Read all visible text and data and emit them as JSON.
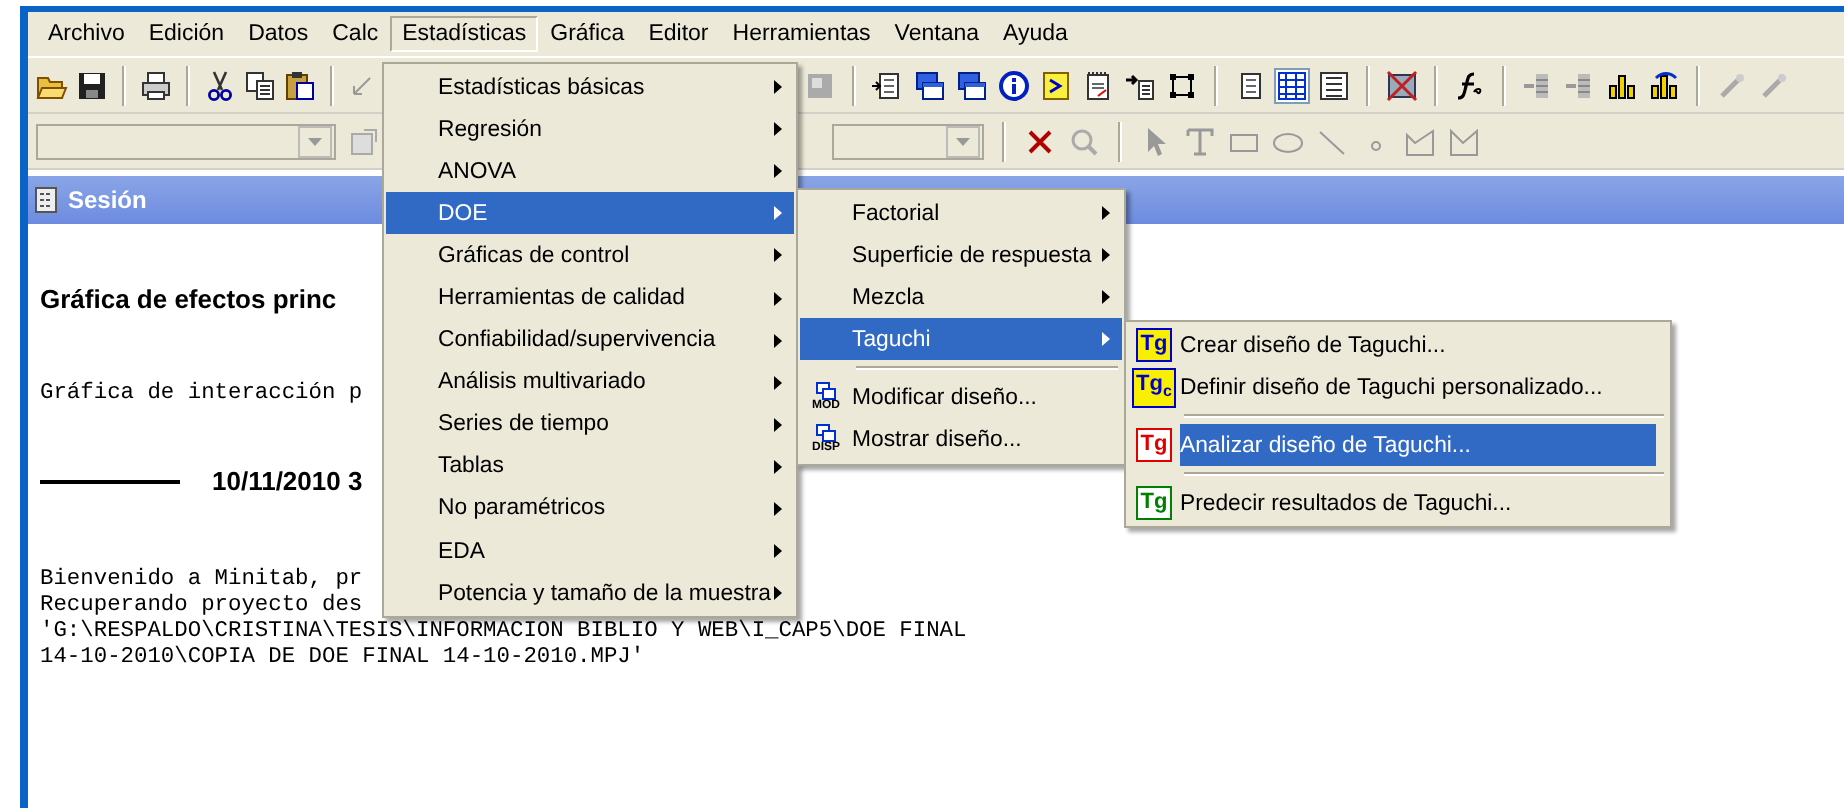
{
  "menu_bar": [
    {
      "label": "Archivo",
      "selected": false
    },
    {
      "label": "Edición",
      "selected": false
    },
    {
      "label": "Datos",
      "selected": false
    },
    {
      "label": "Calc",
      "selected": false
    },
    {
      "label": "Estadísticas",
      "selected": true
    },
    {
      "label": "Gráfica",
      "selected": false
    },
    {
      "label": "Editor",
      "selected": false
    },
    {
      "label": "Herramientas",
      "selected": false
    },
    {
      "label": "Ventana",
      "selected": false
    },
    {
      "label": "Ayuda",
      "selected": false
    }
  ],
  "session": {
    "title": "Sesión",
    "lines": [
      {
        "kind": "heading",
        "text": "Gráfica de efectos princ"
      },
      {
        "kind": "mono",
        "text": "Gráfica de interacción p"
      },
      {
        "kind": "dated",
        "text": "10/11/2010 3"
      },
      {
        "kind": "mono",
        "text": "Bienvenido a Minitab, pr"
      },
      {
        "kind": "mono",
        "text": "Recuperando proyecto des"
      },
      {
        "kind": "mono",
        "text": "'G:\\RESPALDO\\CRISTINA\\TESIS\\INFORMACION BIBLIO Y WEB\\I_CAP5\\DOE FINAL"
      },
      {
        "kind": "mono",
        "text": "14-10-2010\\COPIA DE DOE FINAL 14-10-2010.MPJ'"
      }
    ]
  },
  "stat_menu": [
    {
      "kind": "item",
      "label": "Estadísticas básicas",
      "selected": false
    },
    {
      "kind": "item",
      "label": "Regresión",
      "selected": false
    },
    {
      "kind": "item",
      "label": "ANOVA",
      "selected": false
    },
    {
      "kind": "item",
      "label": "DOE",
      "selected": true
    },
    {
      "kind": "item",
      "label": "Gráficas de control",
      "selected": false
    },
    {
      "kind": "item",
      "label": "Herramientas de calidad",
      "selected": false
    },
    {
      "kind": "item",
      "label": "Confiabilidad/supervivencia",
      "selected": false
    },
    {
      "kind": "item",
      "label": "Análisis multivariado",
      "selected": false
    },
    {
      "kind": "item",
      "label": "Series de tiempo",
      "selected": false
    },
    {
      "kind": "item",
      "label": "Tablas",
      "selected": false
    },
    {
      "kind": "item",
      "label": "No paramétricos",
      "selected": false
    },
    {
      "kind": "item",
      "label": "EDA",
      "selected": false
    },
    {
      "kind": "item",
      "label": "Potencia y tamaño de la muestra",
      "selected": false
    }
  ],
  "doe_menu": [
    {
      "kind": "submenu",
      "label": "Factorial",
      "selected": false
    },
    {
      "kind": "submenu",
      "label": "Superficie de respuesta",
      "selected": false
    },
    {
      "kind": "submenu",
      "label": "Mezcla",
      "selected": false
    },
    {
      "kind": "submenu",
      "label": "Taguchi",
      "selected": true
    },
    {
      "kind": "separator"
    },
    {
      "kind": "command",
      "label": "Modificar diseño...",
      "badge": "MOD",
      "selected": false
    },
    {
      "kind": "command",
      "label": "Mostrar diseño...",
      "badge": "DISP",
      "selected": false
    }
  ],
  "taguchi_menu": [
    {
      "kind": "command",
      "label": "Crear diseño de Taguchi...",
      "badge": "Tg",
      "color": "#0000cc",
      "selected": false
    },
    {
      "kind": "command",
      "label": "Definir diseño de Taguchi personalizado...",
      "badge": "Tg",
      "sub": "c",
      "color": "#0000cc",
      "selected": false
    },
    {
      "kind": "separator"
    },
    {
      "kind": "command",
      "label": "Analizar diseño de Taguchi...",
      "badge": "Tg",
      "color": "#e00000",
      "selected": true
    },
    {
      "kind": "separator"
    },
    {
      "kind": "command",
      "label": "Predecir resultados de Taguchi...",
      "badge": "Tg",
      "color": "#008000",
      "selected": false
    }
  ]
}
